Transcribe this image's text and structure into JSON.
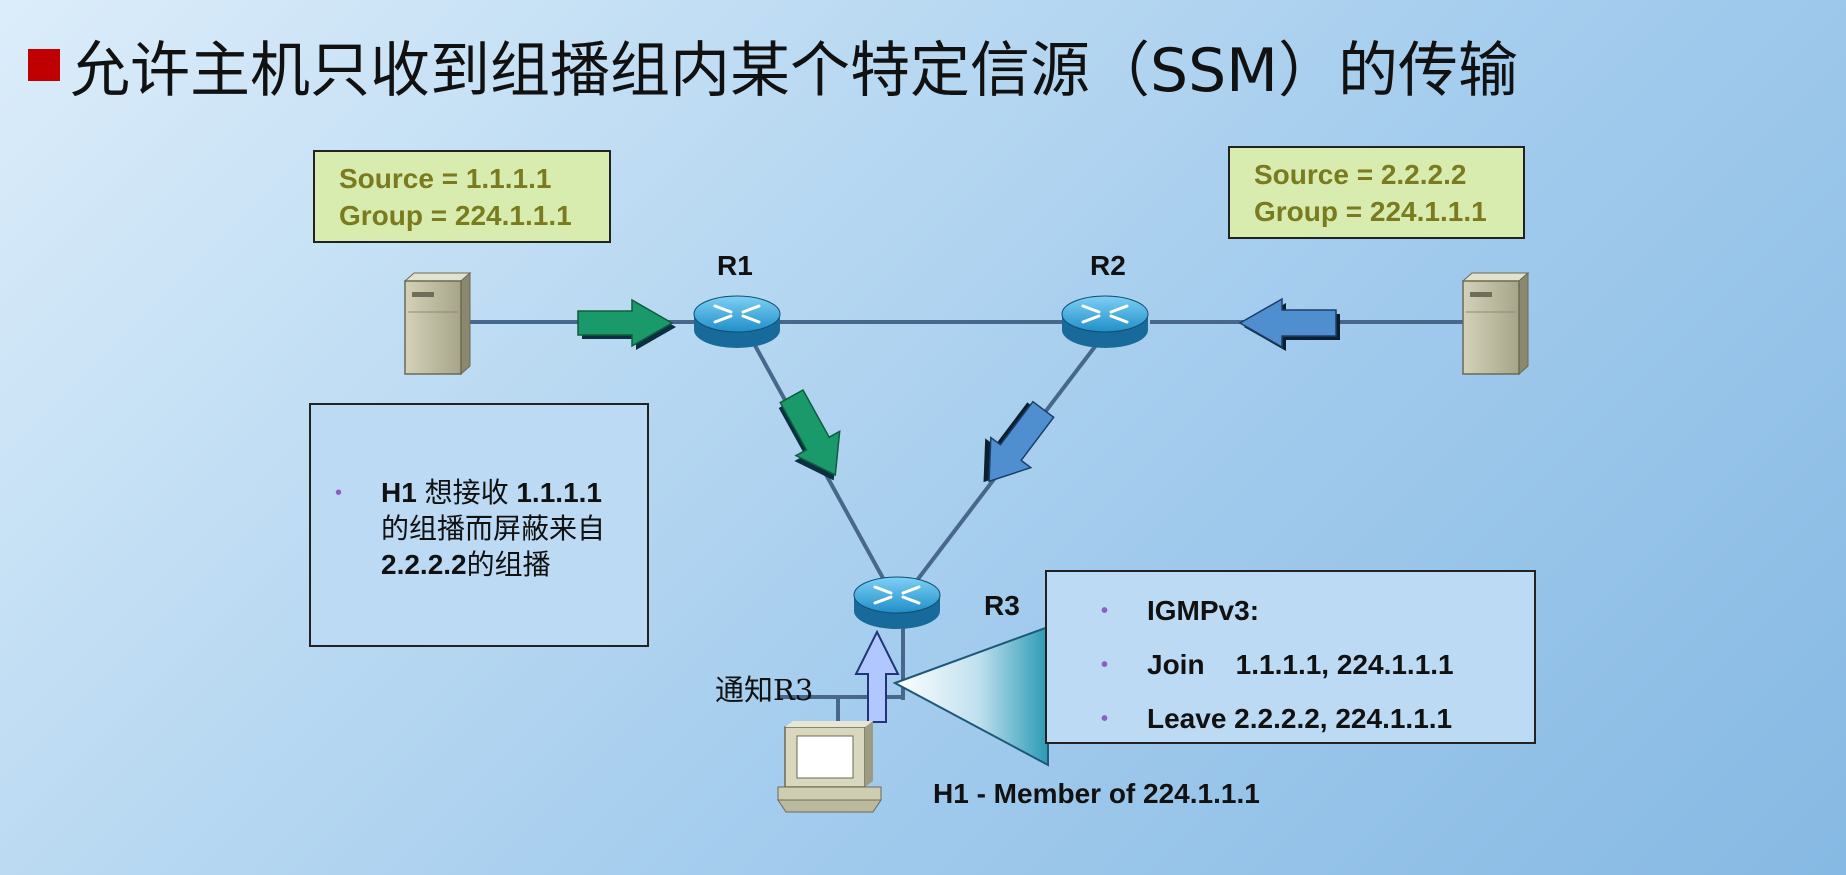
{
  "title": "允许主机只收到组播组内某个特定信源（SSM）的传输",
  "source1": {
    "line1": "Source = 1.1.1.1",
    "line2": "Group = 224.1.1.1"
  },
  "source2": {
    "line1": "Source  = 2.2.2.2",
    "line2": "Group = 224.1.1.1"
  },
  "routers": {
    "r1": "R1",
    "r2": "R2",
    "r3": "R3"
  },
  "note": {
    "h1": "H1",
    "t1": " 想接收 ",
    "ip1": "1.1.1.1",
    "t2": "的组播而屏蔽来自",
    "ip2": "2.2.2.2",
    "t3": "的组播"
  },
  "igmp": {
    "items": [
      "IGMPv3:",
      "Join    1.1.1.1, 224.1.1.1",
      "Leave 2.2.2.2, 224.1.1.1"
    ]
  },
  "notify_label": "通知R3",
  "host_label": "H1 - Member of 224.1.1.1",
  "colors": {
    "green_arrow": "#1a9a6a",
    "blue_arrow": "#4f8fd0",
    "light_arrow": "#b0c8ff",
    "title_bullet": "#c00000"
  }
}
